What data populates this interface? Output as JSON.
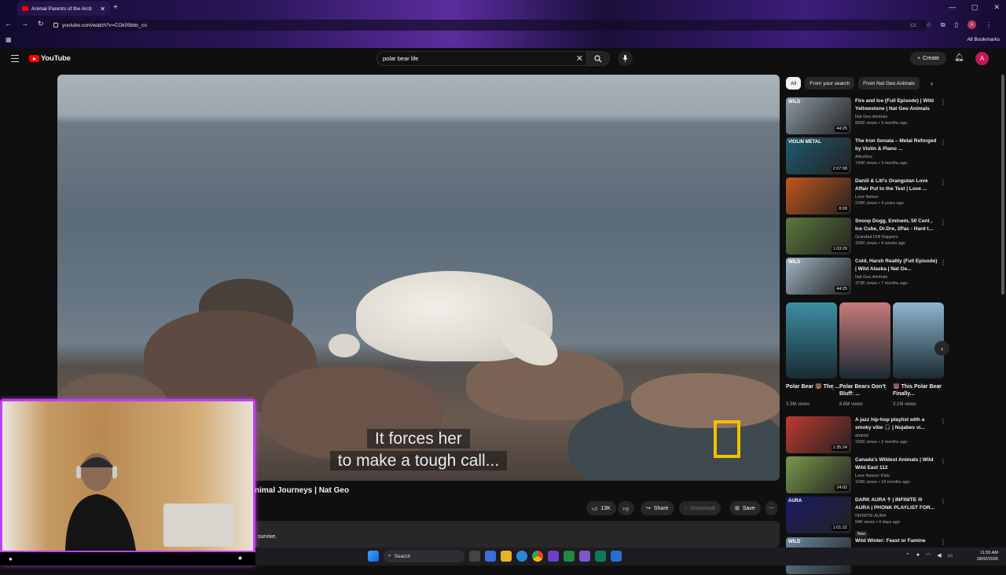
{
  "browser": {
    "tab_title": "Animal Parents of the Arcti",
    "url": "youtube.com/watch?v=COk05bbc_co",
    "all_bookmarks": "All Bookmarks",
    "profile_initial": "A"
  },
  "youtube": {
    "logo_text": "YouTube",
    "search_query": "polar bear life",
    "create_label": "Create",
    "avatar_initial": "A"
  },
  "player": {
    "subtitle_line1": "It forces her",
    "subtitle_line2": "to make a tough call..."
  },
  "video": {
    "title": "nimal Journeys | Nat Geo",
    "likes": "13K",
    "share_label": "Share",
    "download_label": "Download",
    "save_label": "Save",
    "description_snippet": "survive."
  },
  "chips": [
    "All",
    "From your search",
    "From Nat Geo Animals"
  ],
  "recommendations": [
    {
      "title": "Fire and Ice (Full Episode) | Wild Yellowstone | Nat Geo Animals",
      "channel": "Nat Geo Animals",
      "views": "855K views • 9 months ago",
      "duration": "44:25",
      "thumb_color": "#8b9aa6",
      "badge": "WILD"
    },
    {
      "title": "The Iron Sonata – Metal Reforged by Violin & Piano ...",
      "channel": "AltosRox",
      "views": "743K views • 3 months ago",
      "duration": "2:07:08",
      "thumb_color": "#1f5a6e",
      "badge": "VIOLIN METAL"
    },
    {
      "title": "Daniil & Liti's Orangutan Love Affair Put to the Test | Love ...",
      "channel": "Love Nature",
      "views": "229K views • 4 years ago",
      "duration": "8:09",
      "thumb_color": "#c4571c",
      "badge": ""
    },
    {
      "title": "Snoop Dogg, Eminem, 50 Cent , Ice Cube, Dr.Dre, 2Pac - Hard t...",
      "channel": "Grandad Drill Rappers",
      "views": "156K views • 4 weeks ago",
      "duration": "1:03:29",
      "thumb_color": "#5a7a3a",
      "badge": ""
    },
    {
      "title": "Cold, Harsh Reality (Full Episode) | Wild Alaska | Nat Ge...",
      "channel": "Nat Geo Animals",
      "views": "373K views • 7 months ago",
      "duration": "44:25",
      "thumb_color": "#9fb6c4",
      "badge": "WILD"
    }
  ],
  "shorts": [
    {
      "title": "Polar Bear 🐻 The ...",
      "views": "3.3M views",
      "color": "#3d8fa3"
    },
    {
      "title": "Polar Bears Don't Bluff: ...",
      "views": "6.6M views",
      "color": "#c97a7a"
    },
    {
      "title": "🐻 This Polar Bear Finally...",
      "views": "3.1M views",
      "color": "#8fb5cc"
    }
  ],
  "recommendations2": [
    {
      "title": "A jazz hip-hop playlist with a smoky vibe 🎧 | Nujabes vi...",
      "channel": "dndotd",
      "views": "155K views • 2 months ago",
      "duration": "1:35:24",
      "thumb_color": "#c13a2e",
      "badge": "",
      "new": ""
    },
    {
      "title": "Canada's Wildest Animals | Wild Wild East 112",
      "channel": "Love Nature: Kids",
      "views": "169K views • 10 months ago",
      "duration": "24:02",
      "thumb_color": "#7a9a4a",
      "badge": "",
      "new": ""
    },
    {
      "title": "DARK AURA ☥ | INFINITE ♾ AURA | PHONK PLAYLIST FOR...",
      "channel": "INFINITE AURA",
      "views": "54K views • 4 days ago",
      "duration": "1:01:22",
      "thumb_color": "#1b1b66",
      "badge": "AURA",
      "new": "New"
    },
    {
      "title": "Wild Winter: Feast or Famine",
      "channel": "",
      "views": "",
      "duration": "",
      "thumb_color": "#6a8aa0",
      "badge": "WILD",
      "new": ""
    }
  ],
  "taskbar": {
    "search_label": "Search",
    "time": "11:55 AM",
    "date": "18/02/2026"
  }
}
